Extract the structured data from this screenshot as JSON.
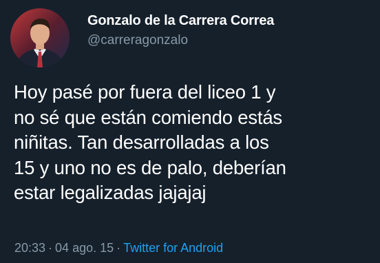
{
  "author": {
    "display_name": "Gonzalo de la Carrera Correa",
    "handle": "@carreragonzalo",
    "avatar_icon": "profile-photo"
  },
  "tweet": {
    "lines": [
      "Hoy pasé por fuera del liceo 1 y",
      "no sé que están comiendo estás",
      "niñitas. Tan desarrolladas a los",
      "15 y uno no es de palo, deberían",
      "estar legalizadas jajajaj"
    ]
  },
  "meta": {
    "time": "20:33",
    "separator": "·",
    "date": "04 ago. 15",
    "source": "Twitter for Android"
  },
  "colors": {
    "background": "#15202b",
    "text": "#ffffff",
    "secondary": "#8899a6",
    "link": "#1da1f2"
  }
}
